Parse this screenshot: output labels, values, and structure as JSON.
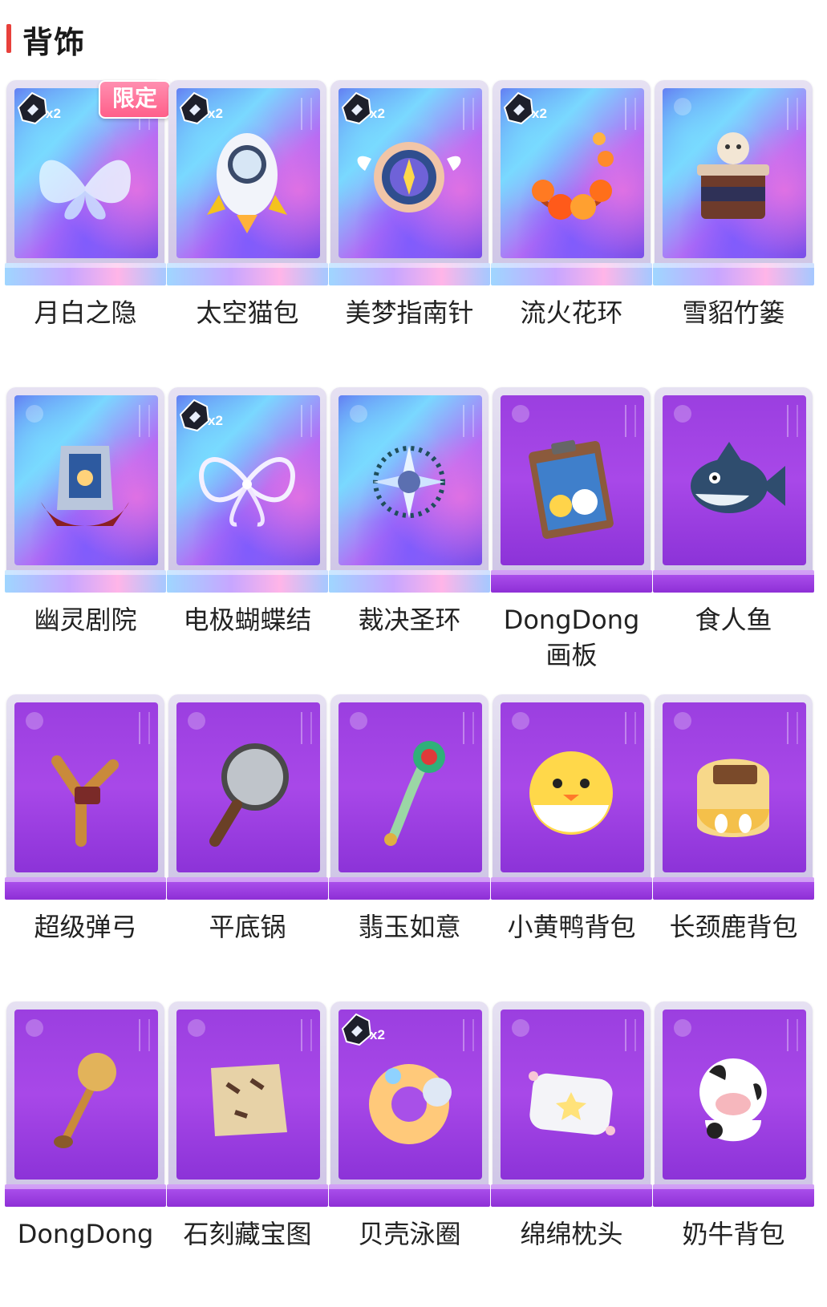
{
  "section": {
    "title": "背饰"
  },
  "colors": {
    "accent": "#e8403b",
    "holo": "#7a4fe8",
    "purple": "#9b3fe0",
    "limited_badge": "#ff5f8a"
  },
  "rows": [
    {
      "items": [
        {
          "name": "月白之隐",
          "badge": "x2",
          "tag": "限定",
          "style": "holo",
          "icon": "wings-icon"
        },
        {
          "name": "太空猫包",
          "badge": "x2",
          "style": "holo",
          "icon": "rocket-icon"
        },
        {
          "name": "美梦指南针",
          "badge": "x2",
          "style": "holo",
          "icon": "compass-icon"
        },
        {
          "name": "流火花环",
          "badge": "x2",
          "style": "holo",
          "icon": "flower-wreath-icon"
        },
        {
          "name": "雪貂竹篓",
          "style": "holo",
          "icon": "basket-icon"
        }
      ]
    },
    {
      "items": [
        {
          "name": "幽灵剧院",
          "style": "holo",
          "icon": "theater-icon"
        },
        {
          "name": "电极蝴蝶结",
          "badge": "x2",
          "style": "holo",
          "icon": "bow-icon"
        },
        {
          "name": "裁决圣环",
          "style": "holo",
          "icon": "halo-icon"
        },
        {
          "name": "DongDong画板",
          "style": "purple",
          "icon": "clipboard-icon"
        },
        {
          "name": "食人鱼",
          "style": "purple",
          "icon": "piranha-icon"
        }
      ]
    },
    {
      "items": [
        {
          "name": "超级弹弓",
          "style": "purple",
          "icon": "slingshot-icon"
        },
        {
          "name": "平底锅",
          "style": "purple",
          "icon": "frying-pan-icon"
        },
        {
          "name": "翡玉如意",
          "style": "purple",
          "icon": "ruyi-scepter-icon"
        },
        {
          "name": "小黄鸭背包",
          "style": "purple",
          "icon": "duck-backpack-icon"
        },
        {
          "name": "长颈鹿背包",
          "style": "purple",
          "icon": "giraffe-backpack-icon"
        }
      ]
    },
    {
      "items": [
        {
          "name": "DongDong",
          "style": "purple",
          "icon": "honey-dipper-icon"
        },
        {
          "name": "石刻藏宝图",
          "style": "purple",
          "icon": "treasure-map-icon"
        },
        {
          "name": "贝壳泳圈",
          "badge": "x2",
          "style": "purple",
          "icon": "swim-ring-icon"
        },
        {
          "name": "绵绵枕头",
          "style": "purple",
          "icon": "pillow-icon"
        },
        {
          "name": "奶牛背包",
          "style": "purple",
          "icon": "cow-backpack-icon"
        }
      ]
    }
  ]
}
